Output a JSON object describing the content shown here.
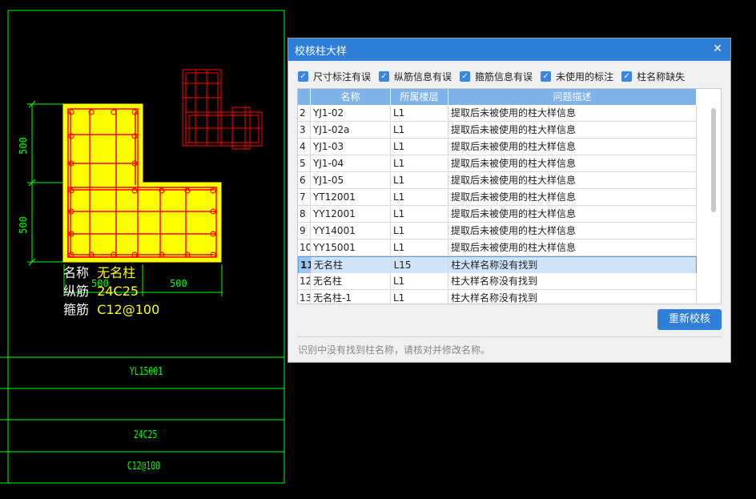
{
  "drawing": {
    "dims": [
      "500",
      "500",
      "500",
      "500"
    ],
    "info": {
      "name_label": "名称",
      "name_value": "无名柱",
      "long_label": "纵筋",
      "long_value": "24C25",
      "stirrup_label": "箍筋",
      "stirrup_value": "C12@100"
    },
    "table": {
      "name": "YL15001",
      "rebar": "24C25",
      "stirrup": "C12@100"
    },
    "colors": {
      "frame": "#00ff00",
      "fill": "#ffff00",
      "rebar": "#ff0000"
    }
  },
  "dialog": {
    "title": "校核柱大样",
    "close_icon": "close-icon",
    "filters": [
      "尺寸标注有误",
      "纵筋信息有误",
      "箍筋信息有误",
      "未使用的标注",
      "柱名称缺失"
    ],
    "columns": [
      "名称",
      "所属楼层",
      "问题描述"
    ],
    "rows": [
      {
        "no": "2",
        "name": "YJ1-02",
        "floor": "L1",
        "desc": "提取后未被使用的柱大样信息"
      },
      {
        "no": "3",
        "name": "YJ1-02a",
        "floor": "L1",
        "desc": "提取后未被使用的柱大样信息"
      },
      {
        "no": "4",
        "name": "YJ1-03",
        "floor": "L1",
        "desc": "提取后未被使用的柱大样信息"
      },
      {
        "no": "5",
        "name": "YJ1-04",
        "floor": "L1",
        "desc": "提取后未被使用的柱大样信息"
      },
      {
        "no": "6",
        "name": "YJ1-05",
        "floor": "L1",
        "desc": "提取后未被使用的柱大样信息"
      },
      {
        "no": "7",
        "name": "YT12001",
        "floor": "L1",
        "desc": "提取后未被使用的柱大样信息"
      },
      {
        "no": "8",
        "name": "YY12001",
        "floor": "L1",
        "desc": "提取后未被使用的柱大样信息"
      },
      {
        "no": "9",
        "name": "YY14001",
        "floor": "L1",
        "desc": "提取后未被使用的柱大样信息"
      },
      {
        "no": "10",
        "name": "YY15001",
        "floor": "L1",
        "desc": "提取后未被使用的柱大样信息"
      },
      {
        "no": "11",
        "name": "无名柱",
        "floor": "L15",
        "desc": "柱大样名称没有找到"
      },
      {
        "no": "12",
        "name": "无名柱",
        "floor": "L1",
        "desc": "柱大样名称没有找到"
      },
      {
        "no": "13",
        "name": "无名柱-1",
        "floor": "L1",
        "desc": "柱大样名称没有找到"
      }
    ],
    "selected_row": "11",
    "recheck_label": "重新校核",
    "hint": "识别中没有找到柱名称，请核对并修改名称。",
    "accent": "#2f7ed8"
  }
}
